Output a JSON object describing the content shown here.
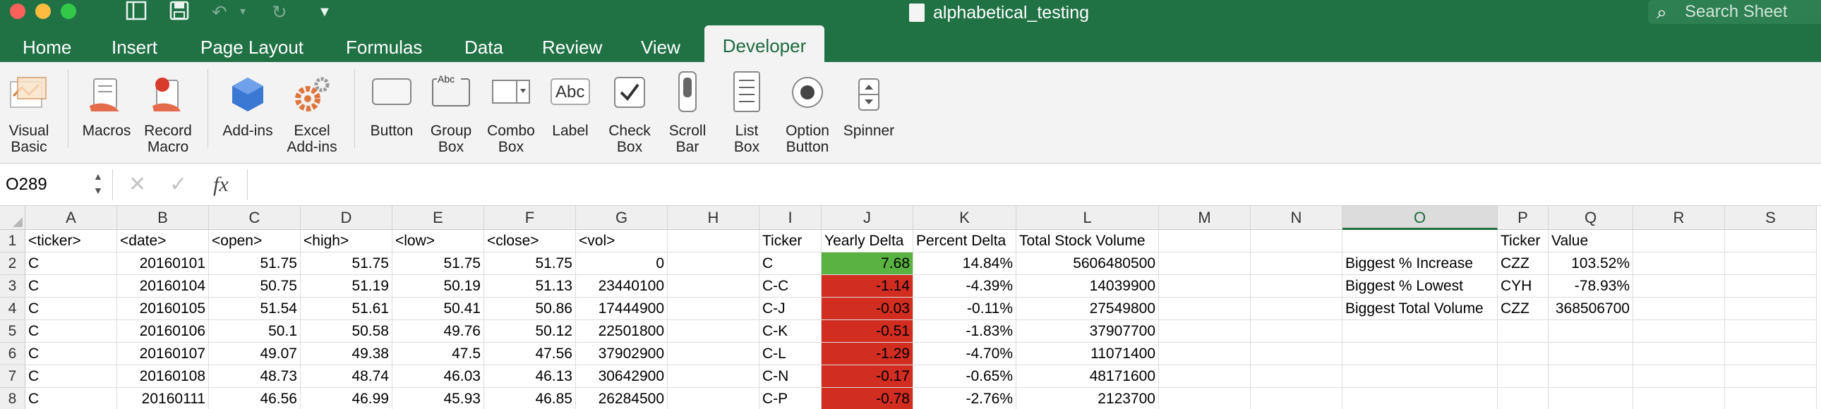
{
  "app": {
    "document_title": "alphabetical_testing",
    "search_placeholder": "Search Sheet"
  },
  "tabs": [
    "Home",
    "Insert",
    "Page Layout",
    "Formulas",
    "Data",
    "Review",
    "View",
    "Developer"
  ],
  "active_tab": "Developer",
  "ribbon": {
    "visual_basic": "Visual\nBasic",
    "macros": "Macros",
    "record_macro": "Record\nMacro",
    "add_ins": "Add-ins",
    "excel_add_ins": "Excel\nAdd-ins",
    "button": "Button",
    "group_box": "Group\nBox",
    "combo_box": "Combo\nBox",
    "label": "Label",
    "check_box": "Check\nBox",
    "scroll_bar": "Scroll\nBar",
    "list_box": "List\nBox",
    "option_button": "Option\nButton",
    "spinner": "Spinner",
    "groupbox_icon_text": "Abc",
    "label_icon_text": "Abc"
  },
  "formula_bar": {
    "name_box": "O289",
    "fx": "fx",
    "formula": ""
  },
  "sheet": {
    "selected_column": "O",
    "columns": [
      "A",
      "B",
      "C",
      "D",
      "E",
      "F",
      "G",
      "H",
      "I",
      "J",
      "K",
      "L",
      "M",
      "N",
      "O",
      "P",
      "Q",
      "R",
      "S"
    ],
    "row_numbers": [
      "1",
      "2",
      "3",
      "4",
      "5",
      "6",
      "7",
      "8"
    ],
    "rows": [
      {
        "A": "<ticker>",
        "B": "<date>",
        "C": "<open>",
        "D": "<high>",
        "E": "<low>",
        "F": "<close>",
        "G": "<vol>",
        "I": "Ticker",
        "J": "Yearly Delta",
        "K": "Percent Delta",
        "L": "Total Stock Volume",
        "P": "Ticker",
        "Q": "Value"
      },
      {
        "A": "C",
        "B": "20160101",
        "C": "51.75",
        "D": "51.75",
        "E": "51.75",
        "F": "51.75",
        "G": "0",
        "I": "C",
        "J": "7.68",
        "K": "14.84%",
        "L": "5606480500",
        "O": "Biggest % Increase",
        "P": "CZZ",
        "Q": "103.52%"
      },
      {
        "A": "C",
        "B": "20160104",
        "C": "50.75",
        "D": "51.19",
        "E": "50.19",
        "F": "51.13",
        "G": "23440100",
        "I": "C-C",
        "J": "-1.14",
        "K": "-4.39%",
        "L": "14039900",
        "O": "Biggest % Lowest",
        "P": "CYH",
        "Q": "-78.93%"
      },
      {
        "A": "C",
        "B": "20160105",
        "C": "51.54",
        "D": "51.61",
        "E": "50.41",
        "F": "50.86",
        "G": "17444900",
        "I": "C-J",
        "J": "-0.03",
        "K": "-0.11%",
        "L": "27549800",
        "O": "Biggest Total Volume",
        "P": "CZZ",
        "Q": "368506700"
      },
      {
        "A": "C",
        "B": "20160106",
        "C": "50.1",
        "D": "50.58",
        "E": "49.76",
        "F": "50.12",
        "G": "22501800",
        "I": "C-K",
        "J": "-0.51",
        "K": "-1.83%",
        "L": "37907700"
      },
      {
        "A": "C",
        "B": "20160107",
        "C": "49.07",
        "D": "49.38",
        "E": "47.5",
        "F": "47.56",
        "G": "37902900",
        "I": "C-L",
        "J": "-1.29",
        "K": "-4.70%",
        "L": "11071400"
      },
      {
        "A": "C",
        "B": "20160108",
        "C": "48.73",
        "D": "48.74",
        "E": "46.03",
        "F": "46.13",
        "G": "30642900",
        "I": "C-N",
        "J": "-0.17",
        "K": "-0.65%",
        "L": "48171600"
      },
      {
        "A": "C",
        "B": "20160111",
        "C": "46.56",
        "D": "46.99",
        "E": "45.93",
        "F": "46.85",
        "G": "26284500",
        "I": "C-P",
        "J": "-0.78",
        "K": "-2.76%",
        "L": "2123700"
      }
    ]
  },
  "colors": {
    "excel_green": "#207245",
    "positive_fill": "#5ab243",
    "negative_fill": "#d12d21"
  }
}
